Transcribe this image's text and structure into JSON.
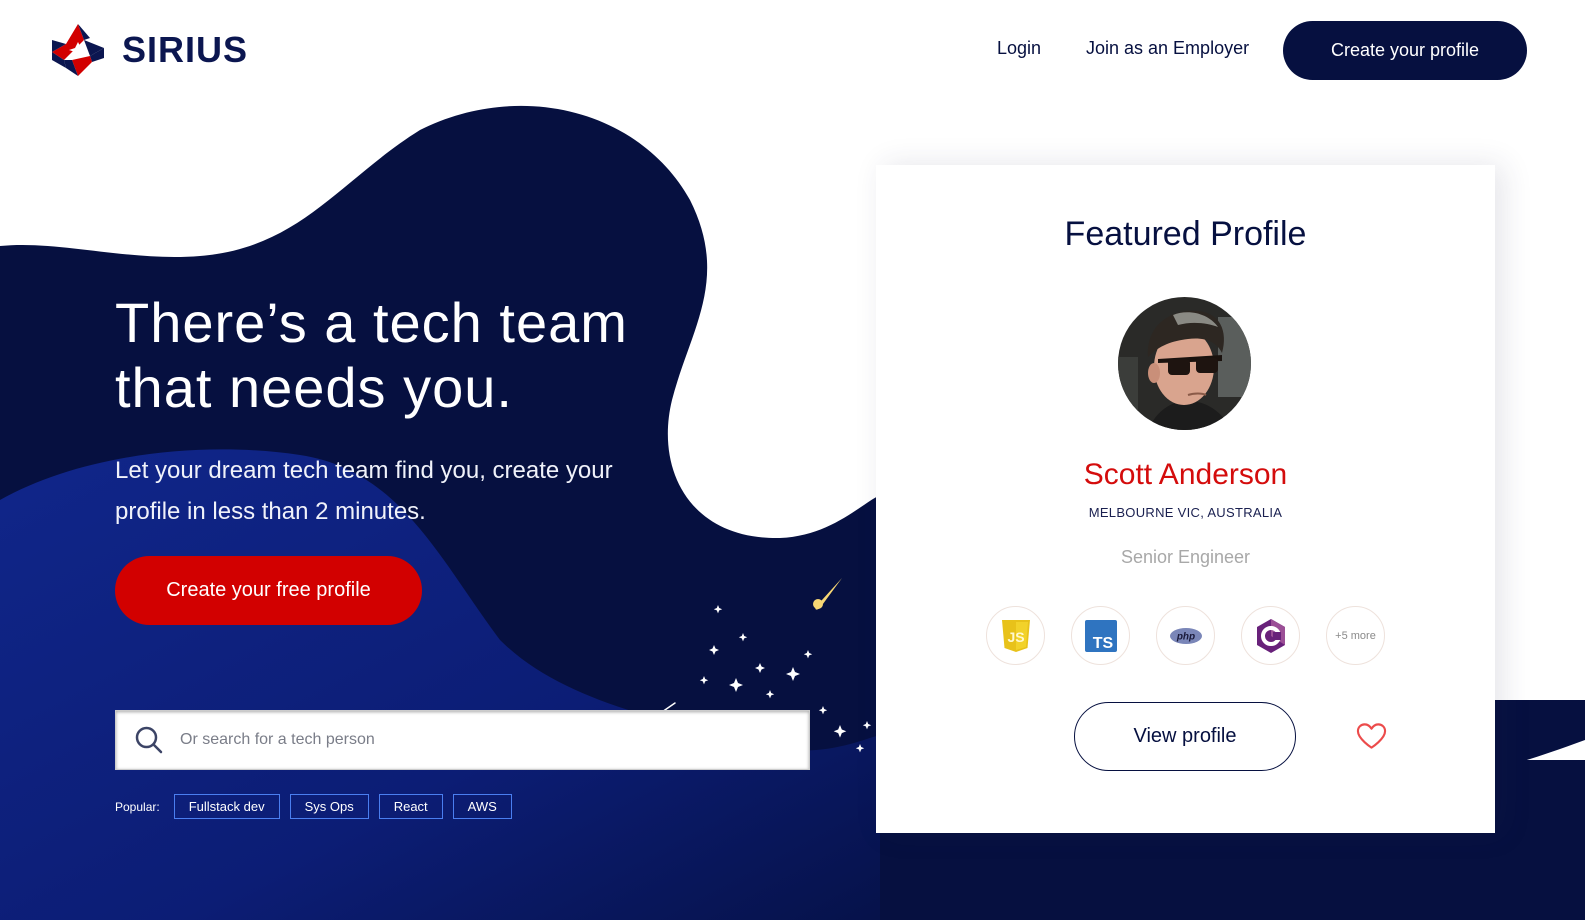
{
  "brand": {
    "name": "SIRIUS",
    "colors": {
      "navy": "#061040",
      "red": "#d20000",
      "royal": "#0f2280",
      "accent_blue": "#4a7ef0",
      "star_yellow": "#f7d774"
    }
  },
  "nav": {
    "login": "Login",
    "employer": "Join as an Employer",
    "cta": "Create your profile"
  },
  "hero": {
    "title": "There’s a tech team that needs you.",
    "subtitle": "Let your dream tech team find you, create your profile in less than 2 minutes.",
    "cta": "Create your free profile"
  },
  "search": {
    "icon": "search-icon",
    "placeholder": "Or search for a tech person",
    "value": ""
  },
  "popular": {
    "label": "Popular:",
    "tags": [
      "Fullstack dev",
      "Sys Ops",
      "React",
      "AWS"
    ]
  },
  "featured": {
    "title": "Featured Profile",
    "name": "Scott Anderson",
    "location": "MELBOURNE VIC, AUSTRALIA",
    "role": "Senior Engineer",
    "skills": [
      {
        "icon": "javascript-icon",
        "label": "JS"
      },
      {
        "icon": "typescript-icon",
        "label": "TS"
      },
      {
        "icon": "php-icon",
        "label": "php"
      },
      {
        "icon": "csharp-icon",
        "label": "C"
      }
    ],
    "more": "+5 more",
    "view_button": "View profile",
    "favorite_icon": "heart-icon"
  }
}
